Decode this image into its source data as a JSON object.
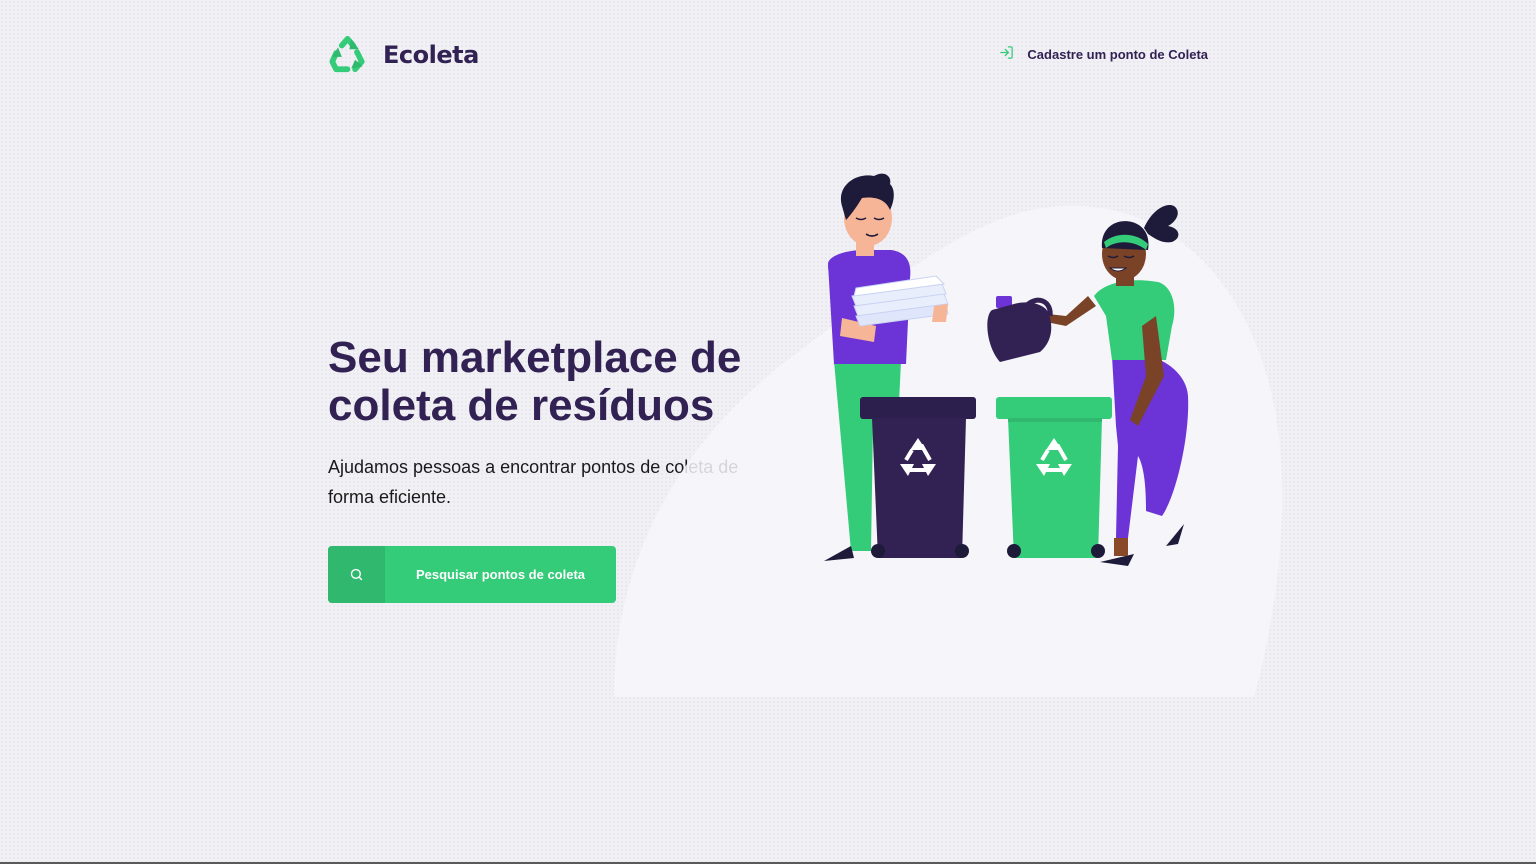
{
  "header": {
    "logo_text": "Ecoleta",
    "signup_link": "Cadastre um ponto de Coleta",
    "signup_icon": "log-in-icon"
  },
  "hero": {
    "title": "Seu marketplace de coleta de resíduos",
    "description": "Ajudamos pessoas a encontrar pontos de coleta de forma eficiente.",
    "search_button": "Pesquisar pontos de coleta",
    "search_icon": "search-icon"
  },
  "colors": {
    "primary": "#34cb79",
    "primary_dark": "#2fb86e",
    "title": "#322153",
    "background": "#f0f0f5",
    "purple": "#6c33d6"
  }
}
